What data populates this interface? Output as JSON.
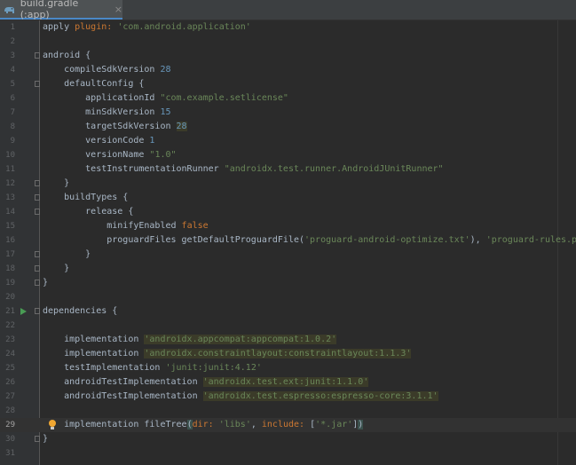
{
  "tab": {
    "title": "build.gradle (:app)",
    "close": "×"
  },
  "current_line": 29,
  "lines": [
    {
      "n": 1,
      "segs": [
        {
          "t": "apply "
        },
        {
          "t": "plugin:",
          "c": "kw"
        },
        {
          "t": " "
        },
        {
          "t": "'com.android.application'",
          "c": "str"
        }
      ]
    },
    {
      "n": 2,
      "segs": []
    },
    {
      "n": 3,
      "segs": [
        {
          "t": "android {"
        }
      ],
      "fold": true
    },
    {
      "n": 4,
      "segs": [
        {
          "t": "    compileSdkVersion "
        },
        {
          "t": "28",
          "c": "num"
        }
      ]
    },
    {
      "n": 5,
      "segs": [
        {
          "t": "    defaultConfig {"
        }
      ],
      "fold": true
    },
    {
      "n": 6,
      "segs": [
        {
          "t": "        applicationId "
        },
        {
          "t": "\"com.example.setlicense\"",
          "c": "str"
        }
      ]
    },
    {
      "n": 7,
      "segs": [
        {
          "t": "        minSdkVersion "
        },
        {
          "t": "15",
          "c": "num"
        }
      ]
    },
    {
      "n": 8,
      "segs": [
        {
          "t": "        targetSdkVersion "
        },
        {
          "t": "28",
          "c": "num hl"
        }
      ]
    },
    {
      "n": 9,
      "segs": [
        {
          "t": "        versionCode "
        },
        {
          "t": "1",
          "c": "num"
        }
      ]
    },
    {
      "n": 10,
      "segs": [
        {
          "t": "        versionName "
        },
        {
          "t": "\"1.0\"",
          "c": "str"
        }
      ]
    },
    {
      "n": 11,
      "segs": [
        {
          "t": "        testInstrumentationRunner "
        },
        {
          "t": "\"androidx.test.runner.AndroidJUnitRunner\"",
          "c": "str"
        }
      ]
    },
    {
      "n": 12,
      "segs": [
        {
          "t": "    }"
        }
      ],
      "fold": true
    },
    {
      "n": 13,
      "segs": [
        {
          "t": "    buildTypes {"
        }
      ],
      "fold": true
    },
    {
      "n": 14,
      "segs": [
        {
          "t": "        release {"
        }
      ],
      "fold": true
    },
    {
      "n": 15,
      "segs": [
        {
          "t": "            minifyEnabled "
        },
        {
          "t": "false",
          "c": "kw"
        }
      ]
    },
    {
      "n": 16,
      "segs": [
        {
          "t": "            proguardFiles getDefaultProguardFile("
        },
        {
          "t": "'proguard-android-optimize.txt'",
          "c": "str"
        },
        {
          "t": "), "
        },
        {
          "t": "'proguard-rules.pro'",
          "c": "str"
        }
      ]
    },
    {
      "n": 17,
      "segs": [
        {
          "t": "        }"
        }
      ],
      "fold": true
    },
    {
      "n": 18,
      "segs": [
        {
          "t": "    }"
        }
      ],
      "fold": true
    },
    {
      "n": 19,
      "segs": [
        {
          "t": "}"
        }
      ],
      "fold": true
    },
    {
      "n": 20,
      "segs": []
    },
    {
      "n": 21,
      "segs": [
        {
          "t": "dependencies {"
        }
      ],
      "fold": true,
      "run": true
    },
    {
      "n": 22,
      "segs": []
    },
    {
      "n": 23,
      "segs": [
        {
          "t": "    implementation "
        },
        {
          "t": "'androidx.appcompat:appcompat:1.0.2'",
          "c": "str hl"
        }
      ]
    },
    {
      "n": 24,
      "segs": [
        {
          "t": "    implementation "
        },
        {
          "t": "'androidx.constraintlayout:constraintlayout:1.1.3'",
          "c": "str hl"
        }
      ]
    },
    {
      "n": 25,
      "segs": [
        {
          "t": "    testImplementation "
        },
        {
          "t": "'junit:junit:4.12'",
          "c": "str"
        }
      ]
    },
    {
      "n": 26,
      "segs": [
        {
          "t": "    androidTestImplementation "
        },
        {
          "t": "'androidx.test.ext:junit:1.1.0'",
          "c": "str hl"
        }
      ]
    },
    {
      "n": 27,
      "segs": [
        {
          "t": "    androidTestImplementation "
        },
        {
          "t": "'androidx.test.espresso:espresso-core:3.1.1'",
          "c": "str hl"
        }
      ]
    },
    {
      "n": 28,
      "segs": []
    },
    {
      "n": 29,
      "segs": [
        {
          "t": "    implementation fileTree"
        },
        {
          "t": "(",
          "c": "brk"
        },
        {
          "t": "dir:",
          "c": "kw"
        },
        {
          "t": " "
        },
        {
          "t": "'libs'",
          "c": "str"
        },
        {
          "t": ", "
        },
        {
          "t": "include:",
          "c": "kw"
        },
        {
          "t": " ["
        },
        {
          "t": "'*.jar'",
          "c": "str"
        },
        {
          "t": "]"
        },
        {
          "t": ")",
          "c": "brk"
        }
      ],
      "bulb": true
    },
    {
      "n": 30,
      "segs": [
        {
          "t": "}"
        }
      ],
      "fold": true
    },
    {
      "n": 31,
      "segs": []
    }
  ]
}
